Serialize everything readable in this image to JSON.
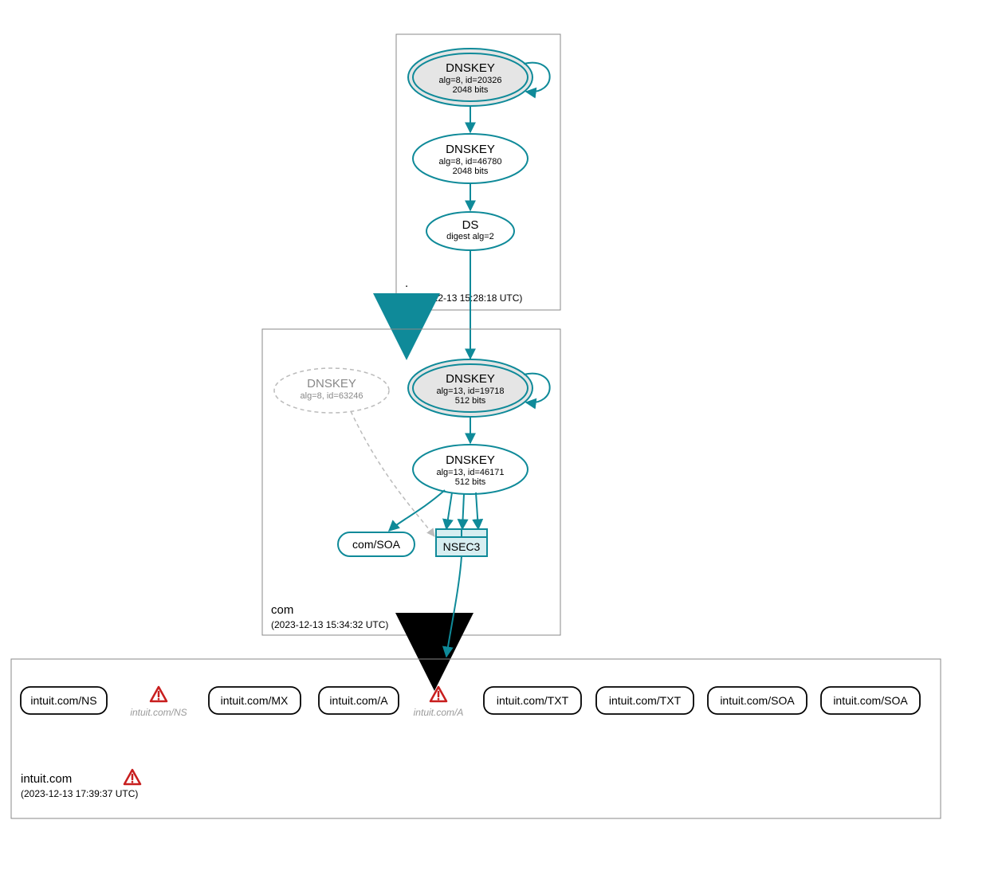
{
  "zones": {
    "root": {
      "name": ".",
      "timestamp": "(2023-12-13 15:28:18 UTC)"
    },
    "com": {
      "name": "com",
      "timestamp": "(2023-12-13 15:34:32 UTC)"
    },
    "intuit": {
      "name": "intuit.com",
      "timestamp": "(2023-12-13 17:39:37 UTC)"
    }
  },
  "nodes": {
    "rootKey1": {
      "title": "DNSKEY",
      "line1": "alg=8, id=20326",
      "line2": "2048 bits"
    },
    "rootKey2": {
      "title": "DNSKEY",
      "line1": "alg=8, id=46780",
      "line2": "2048 bits"
    },
    "ds": {
      "title": "DS",
      "line1": "digest alg=2"
    },
    "comKey1": {
      "title": "DNSKEY",
      "line1": "alg=13, id=19718",
      "line2": "512 bits"
    },
    "comKey2": {
      "title": "DNSKEY",
      "line1": "alg=13, id=46171",
      "line2": "512 bits"
    },
    "comKeyGray": {
      "title": "DNSKEY",
      "line1": "alg=8, id=63246"
    },
    "comSoa": {
      "label": "com/SOA"
    },
    "nsec3": {
      "label": "NSEC3"
    }
  },
  "records": {
    "r1": "intuit.com/NS",
    "r2": "intuit.com/NS",
    "r3": "intuit.com/MX",
    "r4": "intuit.com/A",
    "r5": "intuit.com/A",
    "r6": "intuit.com/TXT",
    "r7": "intuit.com/TXT",
    "r8": "intuit.com/SOA",
    "r9": "intuit.com/SOA"
  }
}
